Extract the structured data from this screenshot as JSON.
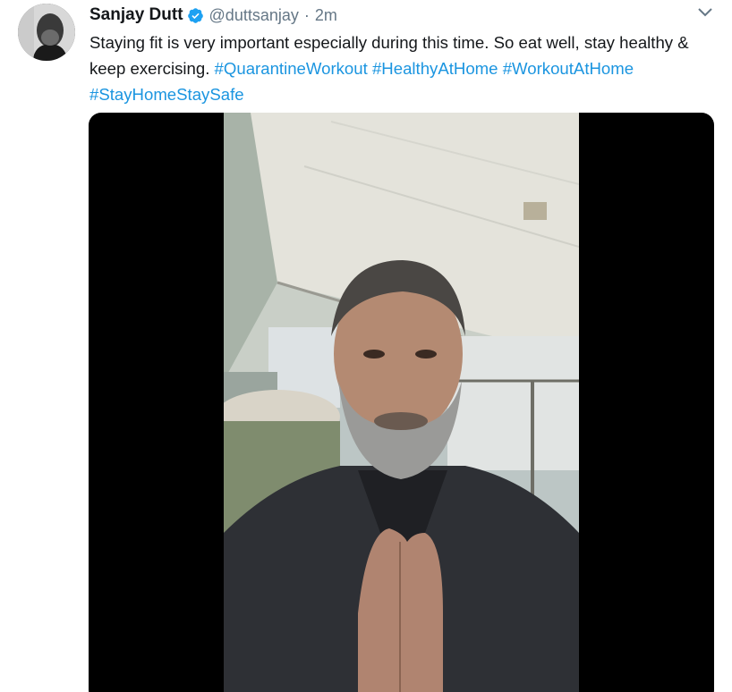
{
  "tweet": {
    "display_name": "Sanjay Dutt",
    "handle": "@duttsanjay",
    "separator": "·",
    "time": "2m",
    "text": "Staying fit is very important especially during this time. So eat well, stay healthy & keep exercising.",
    "hashtags": [
      "#QuarantineWorkout",
      "#HealthyAtHome",
      "#WorkoutAtHome",
      "#StayHomeStaySafe"
    ],
    "verified": true
  },
  "icons": {
    "verified": "verified-badge-icon",
    "caret": "chevron-down-icon"
  },
  "colors": {
    "text": "#14171a",
    "secondary": "#657786",
    "link": "#1b95e0",
    "verified": "#1da1f2",
    "media_bg": "#000000"
  }
}
